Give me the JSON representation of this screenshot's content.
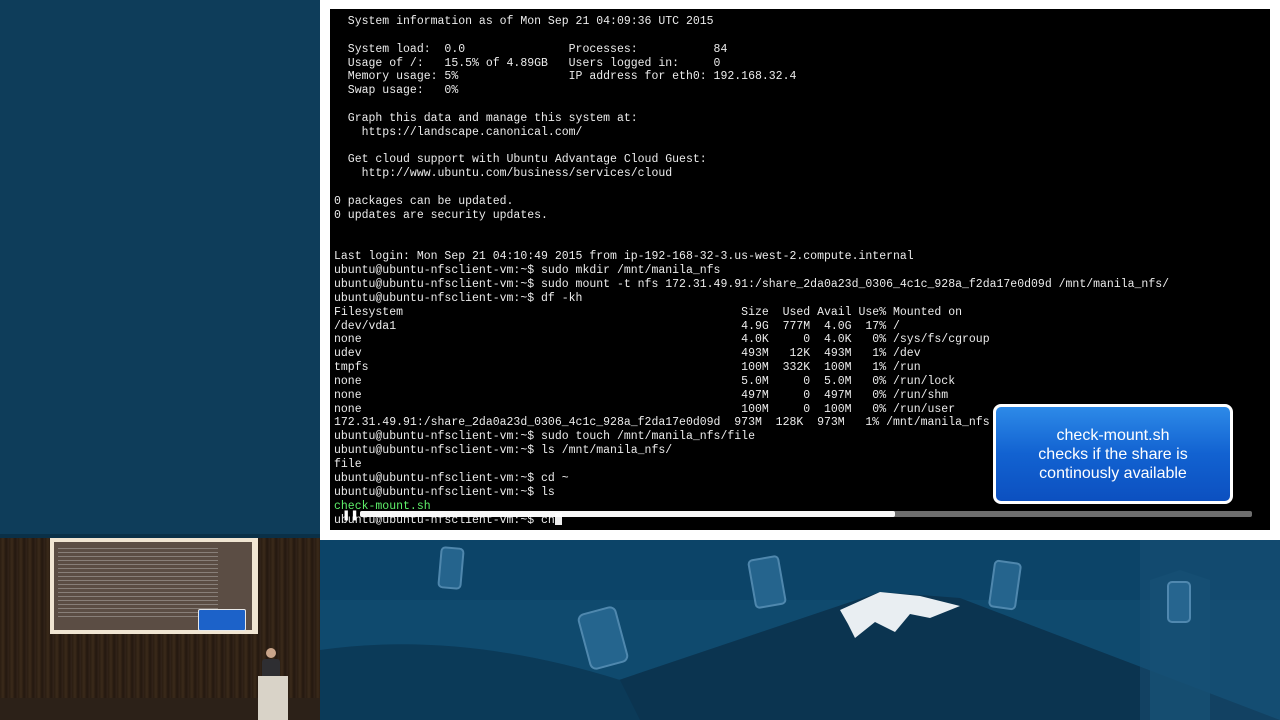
{
  "terminal": {
    "lines": [
      {
        "text": "  System information as of Mon Sep 21 04:09:36 UTC 2015"
      },
      {
        "text": ""
      },
      {
        "text": "  System load:  0.0               Processes:           84"
      },
      {
        "text": "  Usage of /:   15.5% of 4.89GB   Users logged in:     0"
      },
      {
        "text": "  Memory usage: 5%                IP address for eth0: 192.168.32.4"
      },
      {
        "text": "  Swap usage:   0%"
      },
      {
        "text": ""
      },
      {
        "text": "  Graph this data and manage this system at:"
      },
      {
        "text": "    https://landscape.canonical.com/"
      },
      {
        "text": ""
      },
      {
        "text": "  Get cloud support with Ubuntu Advantage Cloud Guest:"
      },
      {
        "text": "    http://www.ubuntu.com/business/services/cloud"
      },
      {
        "text": ""
      },
      {
        "text": "0 packages can be updated."
      },
      {
        "text": "0 updates are security updates."
      },
      {
        "text": ""
      },
      {
        "text": ""
      },
      {
        "text": "Last login: Mon Sep 21 04:10:49 2015 from ip-192-168-32-3.us-west-2.compute.internal"
      },
      {
        "text": "ubuntu@ubuntu-nfsclient-vm:~$ sudo mkdir /mnt/manila_nfs"
      },
      {
        "text": "ubuntu@ubuntu-nfsclient-vm:~$ sudo mount -t nfs 172.31.49.91:/share_2da0a23d_0306_4c1c_928a_f2da17e0d09d /mnt/manila_nfs/"
      },
      {
        "text": "ubuntu@ubuntu-nfsclient-vm:~$ df -kh"
      },
      {
        "text": "Filesystem                                                 Size  Used Avail Use% Mounted on"
      },
      {
        "text": "/dev/vda1                                                  4.9G  777M  4.0G  17% /"
      },
      {
        "text": "none                                                       4.0K     0  4.0K   0% /sys/fs/cgroup"
      },
      {
        "text": "udev                                                       493M   12K  493M   1% /dev"
      },
      {
        "text": "tmpfs                                                      100M  332K  100M   1% /run"
      },
      {
        "text": "none                                                       5.0M     0  5.0M   0% /run/lock"
      },
      {
        "text": "none                                                       497M     0  497M   0% /run/shm"
      },
      {
        "text": "none                                                       100M     0  100M   0% /run/user"
      },
      {
        "text": "172.31.49.91:/share_2da0a23d_0306_4c1c_928a_f2da17e0d09d  973M  128K  973M   1% /mnt/manila_nfs"
      },
      {
        "text": "ubuntu@ubuntu-nfsclient-vm:~$ sudo touch /mnt/manila_nfs/file"
      },
      {
        "text": "ubuntu@ubuntu-nfsclient-vm:~$ ls /mnt/manila_nfs/"
      },
      {
        "text": "file"
      },
      {
        "text": "ubuntu@ubuntu-nfsclient-vm:~$ cd ~"
      },
      {
        "text": "ubuntu@ubuntu-nfsclient-vm:~$ ls"
      },
      {
        "text": "check-mount.sh",
        "color": "green"
      },
      {
        "text": "ubuntu@ubuntu-nfsclient-vm:~$ ch",
        "cursor": true
      }
    ]
  },
  "callout": {
    "lines": [
      "check-mount.sh",
      "checks if the share is",
      "continously available"
    ]
  },
  "video": {
    "progress": 0.6
  },
  "colors": {
    "terminal_bg": "#000000",
    "terminal_fg": "#ececec",
    "ls_file": "#5ff06a",
    "callout": "#1262d1",
    "background": "#0d3b58"
  }
}
